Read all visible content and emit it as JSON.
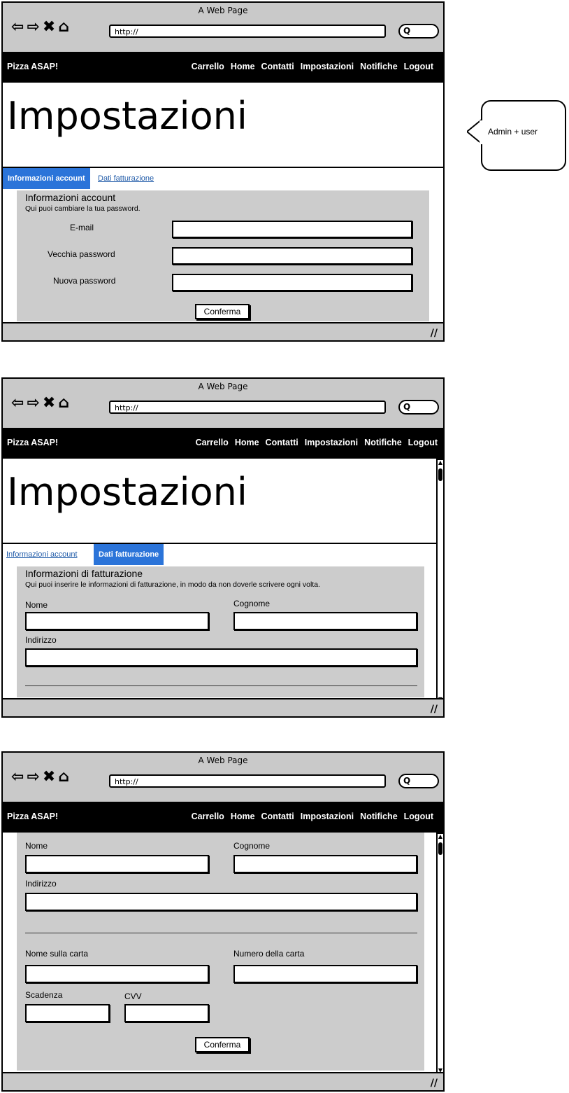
{
  "browser": {
    "title": "A Web Page",
    "url": "http://",
    "nav_glyphs": "⇦⇨✖⌂"
  },
  "navbar": {
    "brand": "Pizza ASAP!",
    "links": [
      "Carrello",
      "Home",
      "Contatti",
      "Impostazioni",
      "Notifiche",
      "Logout"
    ]
  },
  "heading": "Impostazioni",
  "tabs": {
    "account": "Informazioni account",
    "billing": "Dati fatturazione"
  },
  "account_panel": {
    "title": "Informazioni account",
    "subtitle": "Qui puoi cambiare la tua password.",
    "email_label": "E-mail",
    "old_password_label": "Vecchia password",
    "new_password_label": "Nuova password",
    "confirm": "Conferma"
  },
  "billing_panel": {
    "title": "Informazioni di fatturazione",
    "subtitle": "Qui puoi inserire le informazioni di fatturazione, in modo da non doverle scrivere ogni volta.",
    "first_name_label": "Nome",
    "last_name_label": "Cognome",
    "address_label": "Indirizzo",
    "card_name_label": "Nome sulla carta",
    "card_number_label": "Numero della carta",
    "expiry_label": "Scadenza",
    "cvv_label": "CVV",
    "confirm": "Conferma"
  },
  "callout": "Admin + user",
  "colors": {
    "active_tab": "#2b74d9",
    "panel": "#cccccc",
    "chrome": "#c9c9c9"
  }
}
